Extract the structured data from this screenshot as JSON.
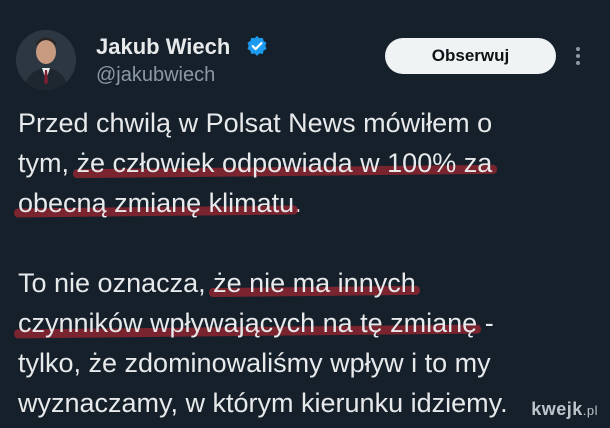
{
  "author": {
    "name": "Jakub Wiech",
    "handle": "@jakubwiech",
    "verified_icon": "verified-badge-icon",
    "accent_color": "#1d9bf0"
  },
  "actions": {
    "follow_label": "Obserwuj",
    "more_icon": "more-vertical-icon"
  },
  "tweet": {
    "paragraph1": {
      "line1": "Przed chwilą w Polsat News mówiłem o",
      "line2_a": "tym, ",
      "line2_b": "że człowiek odpowiada w 100% za",
      "line3_a": "obecną zmianę klimatu",
      "line3_b": "."
    },
    "paragraph2": {
      "line1_a": "To nie oznacza, ",
      "line1_b": "że nie ma innych",
      "line2_a": "czynników wpływających na tę zmianę",
      "line2_b": " -",
      "line3": "tylko, że zdominowaliśmy wpływ i to my",
      "line4": "wyznaczamy, w którym kierunku idziemy."
    },
    "highlight_color": "#9b2530"
  },
  "watermark": {
    "brand": "kwejk",
    "suffix": ".pl"
  }
}
